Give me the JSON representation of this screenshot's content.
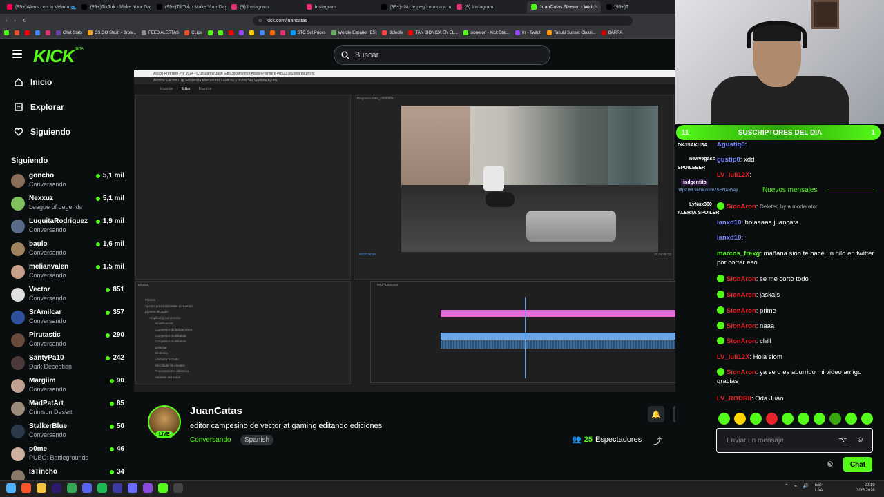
{
  "browser": {
    "tabs": [
      {
        "label": "(99+)Alonso en la Velada 👟 #vel",
        "color": "#ff0050",
        "active": false
      },
      {
        "label": "(99+)TikTok - Make Your Day",
        "color": "#000000",
        "active": false
      },
      {
        "label": "(99+)TikTok - Make Your Day",
        "color": "#000000",
        "active": false
      },
      {
        "label": "(9) Instagram",
        "color": "#e1306c",
        "active": false
      },
      {
        "label": "Instagram",
        "color": "#e1306c",
        "active": false
      },
      {
        "label": "(99+)- No le pegó nunca a nada #",
        "color": "#000000",
        "active": false
      },
      {
        "label": "(9) Instagram",
        "color": "#e1306c",
        "active": false
      },
      {
        "label": "JuanCatas Stream - Watch",
        "color": "#53fc18",
        "active": true
      },
      {
        "label": "(99+)T",
        "color": "#000000",
        "active": false
      }
    ],
    "url": "kick.com/juancatas",
    "bookmarks": [
      {
        "label": "",
        "color": "#53fc18"
      },
      {
        "label": "",
        "color": "#e44d26"
      },
      {
        "label": "",
        "color": "#ff0000"
      },
      {
        "label": "",
        "color": "#4285f4"
      },
      {
        "label": "",
        "color": "#e1306c"
      },
      {
        "label": "Chat Stats",
        "color": "#6441a5"
      },
      {
        "label": "CS:GO Stash - Brow...",
        "color": "#f5a623"
      },
      {
        "label": "FEED ALERTAS",
        "color": "#888888"
      },
      {
        "label": "CLips",
        "color": "#e44d26"
      },
      {
        "label": "",
        "color": "#53fc18"
      },
      {
        "label": "",
        "color": "#53fc18"
      },
      {
        "label": "",
        "color": "#ff0000"
      },
      {
        "label": "",
        "color": "#9147ff"
      },
      {
        "label": "",
        "color": "#ffcc00"
      },
      {
        "label": "",
        "color": "#4285f4"
      },
      {
        "label": "",
        "color": "#ff6600"
      },
      {
        "label": "",
        "color": "#e1306c"
      },
      {
        "label": "STC Set Prices",
        "color": "#0099ff"
      },
      {
        "label": "Wordle Español (ES)",
        "color": "#6aaa64"
      },
      {
        "label": "Boludle",
        "color": "#ff4444"
      },
      {
        "label": "TAN BIONICA EN EL...",
        "color": "#ff0000"
      },
      {
        "label": "sioneron - Kick Stat...",
        "color": "#53fc18"
      },
      {
        "label": "trr - Twitch",
        "color": "#9147ff"
      },
      {
        "label": "Tanuki Sunset Classi...",
        "color": "#ff9900"
      },
      {
        "label": "BARRA",
        "color": "#cc0000"
      }
    ]
  },
  "header": {
    "logo": "KICK",
    "logo_sup": "BETA",
    "search_placeholder": "Buscar"
  },
  "sidebar": {
    "nav": [
      {
        "label": "Inicio",
        "icon": "home-icon"
      },
      {
        "label": "Explorar",
        "icon": "compass-icon"
      },
      {
        "label": "Siguiendo",
        "icon": "heart-icon"
      }
    ],
    "following_title": "Siguiendo",
    "channels": [
      {
        "name": "goncho",
        "category": "Conversando",
        "viewers": "5,1 mil",
        "color": "#8a6f5a"
      },
      {
        "name": "Nexxuz",
        "category": "League of Legends",
        "viewers": "5,1 mil",
        "color": "#7fbf5e"
      },
      {
        "name": "LuquitaRodriguez",
        "category": "Conversando",
        "viewers": "1,9 mil",
        "color": "#5a6b8a"
      },
      {
        "name": "baulo",
        "category": "Conversando",
        "viewers": "1,6 mil",
        "color": "#a0825f"
      },
      {
        "name": "melianvalen",
        "category": "Conversando",
        "viewers": "1,5 mil",
        "color": "#c9a08a"
      },
      {
        "name": "Vector",
        "category": "Conversando",
        "viewers": "851",
        "color": "#e0e0e0"
      },
      {
        "name": "SrAmilcar",
        "category": "Conversando",
        "viewers": "357",
        "color": "#2d4fa0"
      },
      {
        "name": "Pirutastic",
        "category": "Conversando",
        "viewers": "290",
        "color": "#6a4a3a"
      },
      {
        "name": "SantyPa10",
        "category": "Dark Deception",
        "viewers": "242",
        "color": "#4a3a3a"
      },
      {
        "name": "Margiim",
        "category": "Conversando",
        "viewers": "90",
        "color": "#c0a090"
      },
      {
        "name": "MadPatArt",
        "category": "Crimson Desert",
        "viewers": "85",
        "color": "#9a8a7a"
      },
      {
        "name": "StalkerBlue",
        "category": "Conversando",
        "viewers": "50",
        "color": "#2a3a4a"
      },
      {
        "name": "p0me",
        "category": "PUBG: Battlegrounds",
        "viewers": "46",
        "color": "#d0b0a0"
      },
      {
        "name": "IsTincho",
        "category": "",
        "viewers": "34",
        "color": "#8a7a6a"
      }
    ]
  },
  "premiere": {
    "title": "Adobe Premiere Pro 2024 - C:\\Usuarios\\Juan Edit\\Documentos\\Adobe\\Premiere Pro\\22.0\\Sionardo.prproj",
    "menu": "Archivo  Edición  Clip  Secuencia  Marcadores  Gráficos y títulos  Ver  Ventana  Ayuda",
    "tabs": [
      "Importar",
      "Editar",
      "Exportar"
    ],
    "program_label": "Programa: IMG_4463-009",
    "timecode": "00:07:38:29",
    "end_time": "01:04:05:13",
    "effects_label": "Efectos",
    "sequence_label": "IMG_4463-009",
    "effect_items": [
      "Presets",
      "Ajustes preestablecidos de Lumetri",
      "Efectos de audio",
      "Amplitud y compresión",
      "Amplificación",
      "Compresor de banda única",
      "Compresor multibanda",
      "Compresor multibanda",
      "Delimitar",
      "Dinámica",
      "Limitador forzado",
      "Mezclador de canales",
      "Procesamiento dinámico",
      "Volumen del canal"
    ]
  },
  "streamer": {
    "name": "JuanCatas",
    "live": "LIVE",
    "title": "editor campesino de vector at gaming editando ediciones",
    "category": "Conversando",
    "language": "Spanish",
    "viewers_count": "25",
    "viewers_label": "Espectadores"
  },
  "chat": {
    "banner_title": "SUSCRIPTORES DEL DIA",
    "banner_left": "11",
    "banner_right": "1",
    "overlay_labels": [
      "DKJSAKUSA",
      "newvegass",
      "SPOILEEER",
      "indgentito",
      "https://vt.tiktok.com/ZSHNARYej/",
      "LyNux360",
      "ALERTA SPOILER"
    ],
    "new_messages": "Nuevos mensajes",
    "messages": [
      {
        "user": "Agustiq0",
        "text": "",
        "color": "blue",
        "badge": false
      },
      {
        "user": "gustip0",
        "text": "xdd",
        "color": "blue",
        "badge": false
      },
      {
        "user": "LV_luli12X",
        "text": "",
        "color": "red",
        "badge": false
      },
      {
        "user": "SionAron",
        "text": "Deleted by a moderator",
        "color": "red",
        "badge": true
      },
      {
        "user": "ianxd10",
        "text": "holaaaaa juancata",
        "color": "blue",
        "badge": false
      },
      {
        "user": "ianxd10",
        "text": "",
        "color": "blue",
        "badge": false
      },
      {
        "user": "marcos_frexg",
        "text": "mañana sion te hace un hilo en twitter por cortar eso",
        "color": "green",
        "badge": false
      },
      {
        "user": "SionAron",
        "text": "se me corto todo",
        "color": "red",
        "badge": true
      },
      {
        "user": "SionAron",
        "text": "jaskajs",
        "color": "red",
        "badge": true
      },
      {
        "user": "SionAron",
        "text": "prime",
        "color": "red",
        "badge": true
      },
      {
        "user": "SionAron",
        "text": "naaa",
        "color": "red",
        "badge": true
      },
      {
        "user": "SionAron",
        "text": "chill",
        "color": "red",
        "badge": true
      },
      {
        "user": "LV_luli12X",
        "text": "Hola siom",
        "color": "red",
        "badge": false
      },
      {
        "user": "SionAron",
        "text": "ya se q es aburrido mi video amigo gracias",
        "color": "red",
        "badge": true
      },
      {
        "user": "LV_RODRII",
        "text": "Oda Juan",
        "color": "red",
        "badge": false
      }
    ],
    "emote_colors": [
      "#53fc18",
      "#ffd400",
      "#53fc18",
      "#e7242a",
      "#53fc18",
      "#53fc18",
      "#53fc18",
      "#3aa60f",
      "#53fc18",
      "#53fc18"
    ],
    "input_placeholder": "Enviar un mensaje",
    "send_label": "Chat"
  },
  "taskbar": {
    "icons": [
      {
        "name": "windows-icon",
        "color": "#4fb3ff"
      },
      {
        "name": "brave-icon",
        "color": "#fb542b"
      },
      {
        "name": "folder-icon",
        "color": "#f4c542"
      },
      {
        "name": "premiere-icon",
        "color": "#2d1a6b"
      },
      {
        "name": "chrome-icon",
        "color": "#34a853"
      },
      {
        "name": "discord-icon",
        "color": "#5865f2"
      },
      {
        "name": "spotify-icon",
        "color": "#1db954"
      },
      {
        "name": "app-icon",
        "color": "#3a3aa0"
      },
      {
        "name": "app-icon",
        "color": "#6a6aff"
      },
      {
        "name": "app-icon",
        "color": "#8a4ae0"
      },
      {
        "name": "kick-icon",
        "color": "#53fc18"
      },
      {
        "name": "app-icon",
        "color": "#444444"
      }
    ],
    "lang": "ESP",
    "lang2": "LAA",
    "time": "20:19",
    "date": "30/5/2026"
  }
}
